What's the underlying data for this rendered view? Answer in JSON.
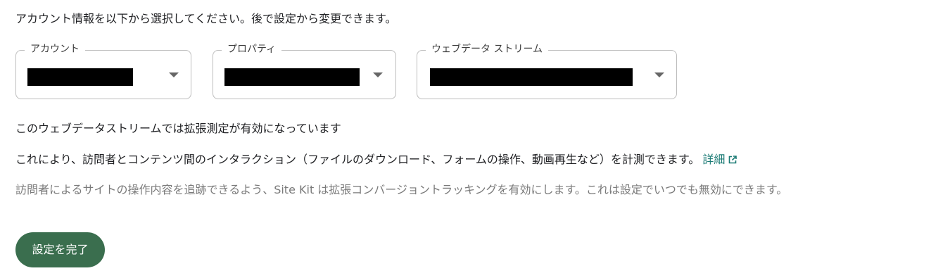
{
  "intro": "アカウント情報を以下から選択してください。後で設定から変更できます。",
  "fields": [
    {
      "label": "アカウント"
    },
    {
      "label": "プロパティ"
    },
    {
      "label": "ウェブデータ ストリーム"
    }
  ],
  "enhanced": {
    "heading": "このウェブデータストリームでは拡張測定が有効になっています",
    "description": "これにより、訪問者とコンテンツ間のインタラクション（ファイルのダウンロード、フォームの操作、動画再生など）を計測できます。",
    "link_label": "詳細",
    "note": "訪問者によるサイトの操作内容を追跡できるよう、Site Kit は拡張コンバージョントラッキングを有効にします。これは設定でいつでも無効にできます。"
  },
  "complete_button": "設定を完了",
  "icons": {
    "dropdown": "chevron-down-icon",
    "link": "external-link-icon"
  },
  "colors": {
    "button": "#3a6e4e",
    "link": "#1a7a74"
  }
}
